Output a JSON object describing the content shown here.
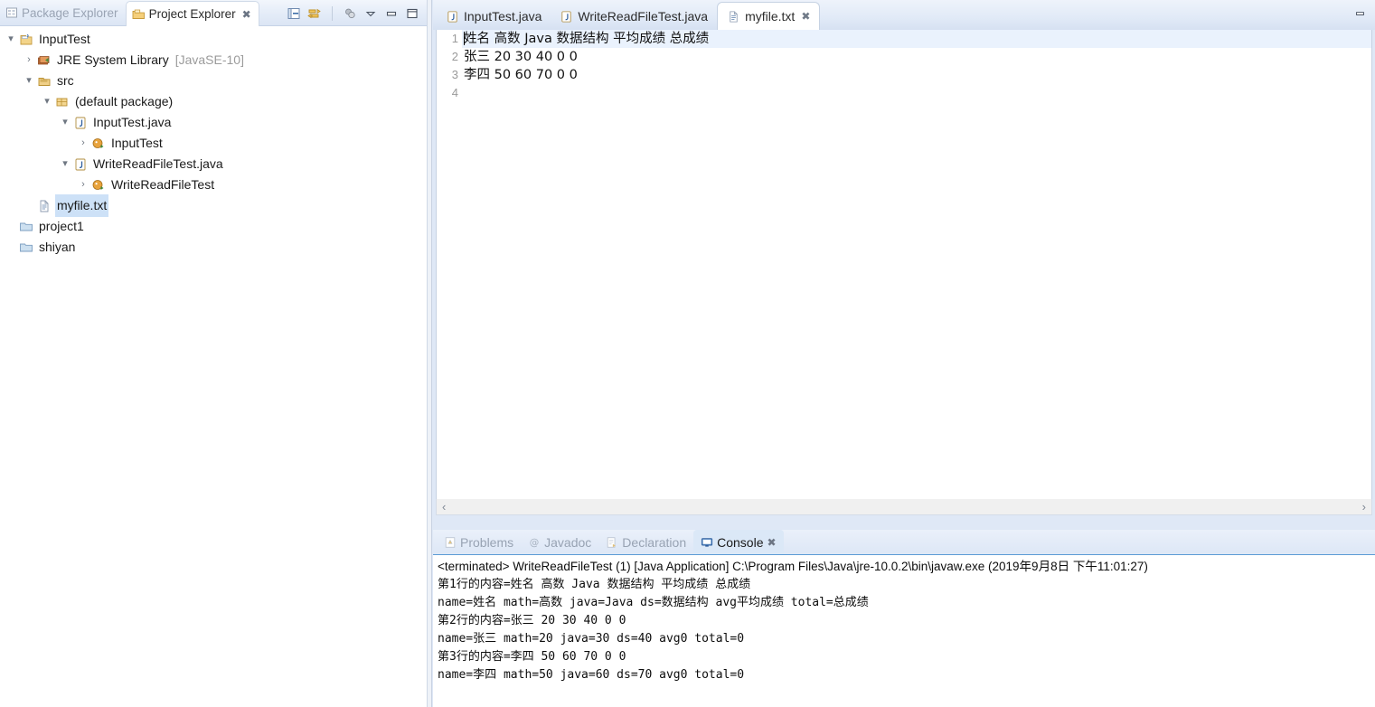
{
  "explorer": {
    "tabs": [
      {
        "label": "Package Explorer",
        "icon": "package-explorer-icon",
        "active": false,
        "closable": false
      },
      {
        "label": "Project Explorer",
        "icon": "project-explorer-icon",
        "active": true,
        "closable": true
      }
    ],
    "toolbar": [
      {
        "name": "collapse-all-icon",
        "tooltip": "Collapse All"
      },
      {
        "name": "link-with-editor-icon",
        "tooltip": "Link with Editor"
      },
      {
        "name": "focus-on-active-task-icon",
        "tooltip": "Focus on Active Task"
      },
      {
        "name": "view-menu-icon",
        "tooltip": "View Menu"
      },
      {
        "name": "minimize-icon",
        "tooltip": "Minimize"
      },
      {
        "name": "maximize-icon",
        "tooltip": "Maximize"
      }
    ],
    "tree": [
      {
        "label": "InputTest",
        "suffix": "",
        "indent": 0,
        "twist": "down",
        "icon": "java-project-icon",
        "selected": false
      },
      {
        "label": "JRE System Library",
        "suffix": "[JavaSE-10]",
        "indent": 1,
        "twist": "right",
        "icon": "library-icon",
        "selected": false
      },
      {
        "label": "src",
        "suffix": "",
        "indent": 1,
        "twist": "down",
        "icon": "source-folder-icon",
        "selected": false
      },
      {
        "label": "(default package)",
        "suffix": "",
        "indent": 2,
        "twist": "down",
        "icon": "package-icon",
        "selected": false
      },
      {
        "label": "InputTest.java",
        "suffix": "",
        "indent": 3,
        "twist": "down",
        "icon": "java-file-icon",
        "selected": false
      },
      {
        "label": "InputTest",
        "suffix": "",
        "indent": 4,
        "twist": "right",
        "icon": "java-class-icon",
        "selected": false
      },
      {
        "label": "WriteReadFileTest.java",
        "suffix": "",
        "indent": 3,
        "twist": "down",
        "icon": "java-file-icon",
        "selected": false
      },
      {
        "label": "WriteReadFileTest",
        "suffix": "",
        "indent": 4,
        "twist": "right",
        "icon": "java-class-icon",
        "selected": false
      },
      {
        "label": "myfile.txt",
        "suffix": "",
        "indent": 1,
        "twist": "none",
        "icon": "text-file-icon",
        "selected": true
      },
      {
        "label": "project1",
        "suffix": "",
        "indent": 0,
        "twist": "none",
        "icon": "folder-icon",
        "selected": false
      },
      {
        "label": "shiyan",
        "suffix": "",
        "indent": 0,
        "twist": "none",
        "icon": "folder-icon",
        "selected": false
      }
    ]
  },
  "editor": {
    "tabs": [
      {
        "label": "InputTest.java",
        "icon": "java-file-icon",
        "active": false,
        "closable": false
      },
      {
        "label": "WriteReadFileTest.java",
        "icon": "java-file-icon",
        "active": false,
        "closable": false
      },
      {
        "label": "myfile.txt",
        "icon": "text-file-icon",
        "active": true,
        "closable": true
      }
    ],
    "minimize_icon": "minimize-icon",
    "line_numbers": [
      "1",
      "2",
      "3",
      "4"
    ],
    "lines": [
      "姓名 高数 Java 数据结构 平均成绩 总成绩",
      "张三 20 30 40 0 0",
      "李四 50 60 70 0 0",
      ""
    ],
    "current_line_index": 0,
    "hscroll": {
      "left_arrow": "‹",
      "right_arrow": "›"
    }
  },
  "console": {
    "tabs": [
      {
        "label": "Problems",
        "icon": "problems-icon",
        "active": false,
        "closable": false
      },
      {
        "label": "Javadoc",
        "icon": "javadoc-icon",
        "active": false,
        "closable": false
      },
      {
        "label": "Declaration",
        "icon": "declaration-icon",
        "active": false,
        "closable": false
      },
      {
        "label": "Console",
        "icon": "console-icon",
        "active": true,
        "closable": true
      }
    ],
    "header": "<terminated> WriteReadFileTest (1) [Java Application] C:\\Program Files\\Java\\jre-10.0.2\\bin\\javaw.exe (2019年9月8日 下午11:01:27)",
    "output": [
      "第1行的内容=姓名 高数 Java 数据结构 平均成绩 总成绩",
      "name=姓名 math=高数 java=Java ds=数据结构 avg平均成绩 total=总成绩",
      "第2行的内容=张三 20 30 40 0 0",
      "name=张三 math=20 java=30 ds=40 avg0 total=0",
      "第3行的内容=李四 50 60 70 0 0",
      "name=李四 math=50 java=60 ds=70 avg0 total=0"
    ]
  },
  "colors": {
    "accent": "#5b9bd5",
    "selection": "#cde1f7",
    "chrome": "#dfe8f6",
    "tab_active": "#ffffff",
    "inactive_text": "#98a3b3",
    "suffix_text": "#9b9b9b"
  }
}
